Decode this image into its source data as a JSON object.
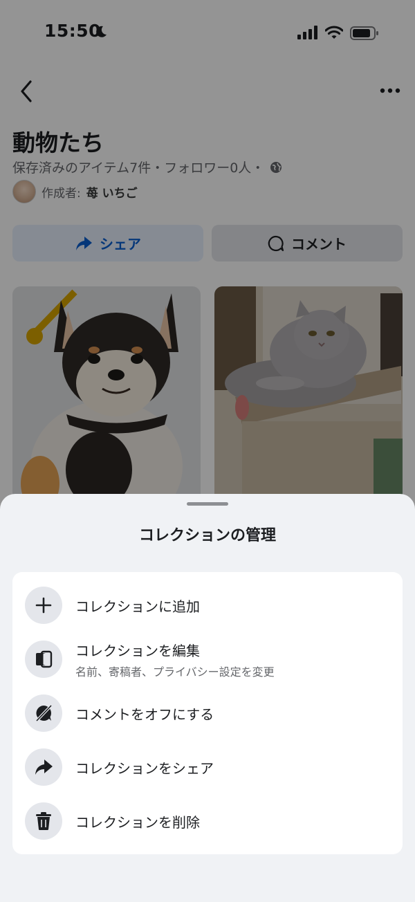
{
  "status_bar": {
    "time": "15:50"
  },
  "collection": {
    "title": "動物たち",
    "meta": "保存済みのアイテム7件・フォロワー0人・",
    "creator_prefix": "作成者:",
    "creator_name": "苺 いちご"
  },
  "actions": {
    "share_label": "シェア",
    "comment_label": "コメント"
  },
  "sheet": {
    "title": "コレクションの管理",
    "items": [
      {
        "icon": "plus-icon",
        "label": "コレクションに追加"
      },
      {
        "icon": "edit-collection-icon",
        "label": "コレクションを編集",
        "sub": "名前、寄稿者、プライバシー設定を変更"
      },
      {
        "icon": "comment-off-icon",
        "label": "コメントをオフにする"
      },
      {
        "icon": "share-icon",
        "label": "コレクションをシェア"
      },
      {
        "icon": "trash-icon",
        "label": "コレクションを削除"
      }
    ]
  },
  "colors": {
    "accent": "#0a5fd1",
    "sheet_bg": "#f0f2f5",
    "icon_bg": "#e4e6eb"
  }
}
